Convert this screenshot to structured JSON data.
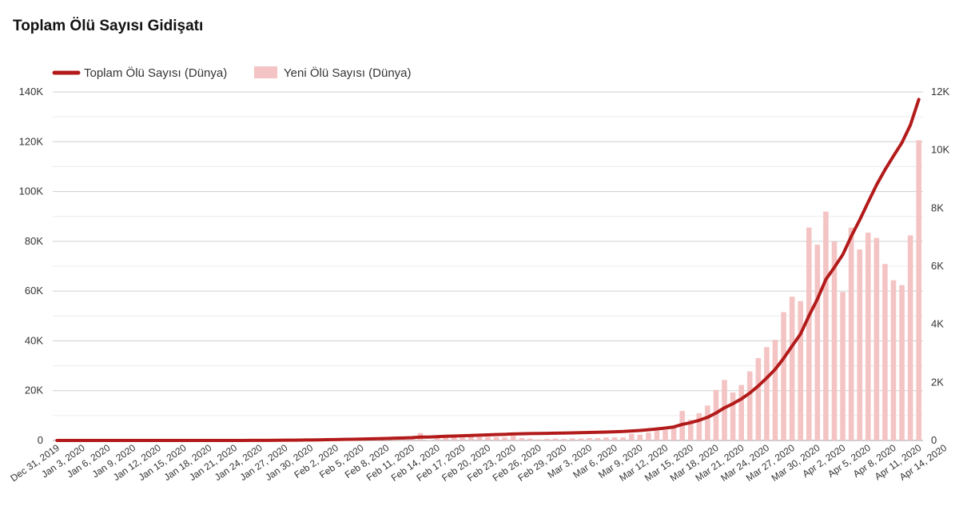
{
  "chart_data": {
    "type": "bar+line",
    "title": "Toplam Ölü Sayısı Gidişatı",
    "legend_position": "top-left",
    "grid": true,
    "colors": {
      "line": "#b31b1b",
      "bars": "#f4c3c3"
    },
    "x_ticks": [
      "Dec 31, 2019",
      "Jan 3, 2020",
      "Jan 6, 2020",
      "Jan 9, 2020",
      "Jan 12, 2020",
      "Jan 15, 2020",
      "Jan 18, 2020",
      "Jan 21, 2020",
      "Jan 24, 2020",
      "Jan 27, 2020",
      "Jan 30, 2020",
      "Feb 2, 2020",
      "Feb 5, 2020",
      "Feb 8, 2020",
      "Feb 11, 2020",
      "Feb 14, 2020",
      "Feb 17, 2020",
      "Feb 20, 2020",
      "Feb 23, 2020",
      "Feb 26, 2020",
      "Feb 29, 2020",
      "Mar 3, 2020",
      "Mar 6, 2020",
      "Mar 9, 2020",
      "Mar 12, 2020",
      "Mar 15, 2020",
      "Mar 18, 2020",
      "Mar 21, 2020",
      "Mar 24, 2020",
      "Mar 27, 2020",
      "Mar 30, 2020",
      "Apr 2, 2020",
      "Apr 5, 2020",
      "Apr 8, 2020",
      "Apr 11, 2020",
      "Apr 14, 2020"
    ],
    "y_left": {
      "ticks": [
        "0",
        "20K",
        "40K",
        "60K",
        "80K",
        "100K",
        "120K",
        "140K"
      ],
      "range": [
        0,
        140000
      ]
    },
    "y_right": {
      "ticks": [
        "0",
        "2K",
        "4K",
        "6K",
        "8K",
        "10K",
        "12K"
      ],
      "range": [
        0,
        12000
      ]
    },
    "series": [
      {
        "name": "Toplam Ölü Sayısı (Dünya)",
        "type": "line",
        "axis": "left",
        "start_date": "2019-12-31",
        "values": [
          0,
          0,
          0,
          0,
          0,
          0,
          0,
          0,
          0,
          0,
          0,
          0,
          0,
          0,
          0,
          0,
          0,
          0,
          0,
          0,
          0,
          0,
          17,
          25,
          41,
          56,
          80,
          106,
          132,
          170,
          213,
          259,
          304,
          361,
          425,
          491,
          564,
          637,
          723,
          812,
          909,
          1017,
          1114,
          1368,
          1381,
          1524,
          1666,
          1772,
          1870,
          2008,
          2126,
          2247,
          2360,
          2460,
          2618,
          2699,
          2763,
          2800,
          2858,
          2924,
          2977,
          3050,
          3117,
          3202,
          3285,
          3387,
          3494,
          3599,
          3827,
          4026,
          4296,
          4628,
          4981,
          5428,
          6444,
          7157,
          8095,
          9297,
          11037,
          13121,
          14772,
          16682,
          19059,
          21896,
          25110,
          28573,
          32991,
          37941,
          42737,
          50066,
          56807,
          64686,
          69529,
          74641,
          81967,
          88542,
          95696,
          102669,
          108744,
          114260,
          119606,
          126666,
          137000
        ]
      },
      {
        "name": "Yeni Ölü Sayısı (Dünya)",
        "type": "bar",
        "axis": "right",
        "start_date": "2019-12-31",
        "values": [
          0,
          0,
          0,
          0,
          0,
          0,
          0,
          0,
          0,
          0,
          0,
          0,
          0,
          0,
          0,
          0,
          0,
          0,
          0,
          0,
          0,
          0,
          17,
          8,
          16,
          15,
          24,
          26,
          26,
          38,
          43,
          46,
          45,
          57,
          64,
          66,
          73,
          73,
          86,
          89,
          97,
          108,
          97,
          254,
          13,
          143,
          142,
          106,
          98,
          138,
          118,
          121,
          113,
          100,
          158,
          81,
          64,
          37,
          58,
          66,
          53,
          73,
          67,
          85,
          83,
          102,
          107,
          105,
          228,
          199,
          270,
          332,
          353,
          447,
          1016,
          713,
          938,
          1202,
          1740,
          2084,
          1651,
          1910,
          2377,
          2837,
          3214,
          3463,
          4418,
          4950,
          4796,
          7329,
          6741,
          7879,
          6843,
          5112,
          7326,
          6575,
          7154,
          6973,
          6075,
          5516,
          5346,
          7060,
          10334
        ]
      }
    ]
  }
}
